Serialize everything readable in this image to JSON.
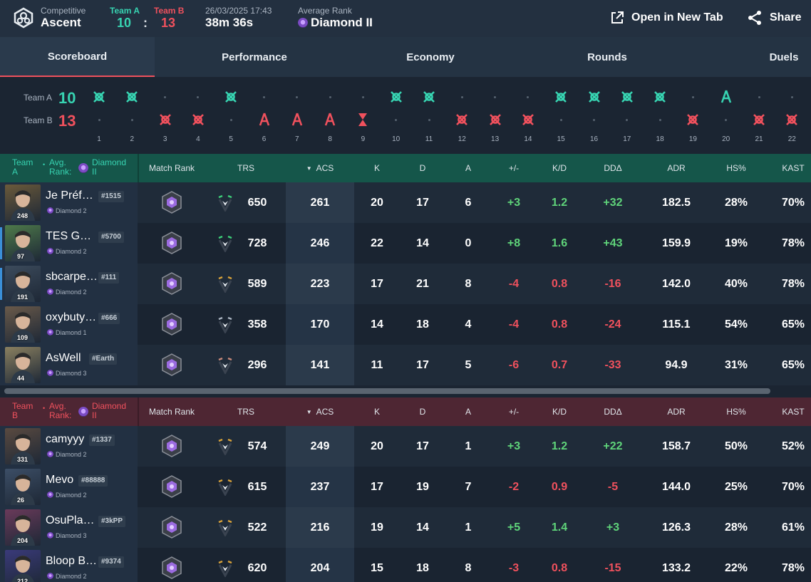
{
  "header": {
    "mode": "Competitive",
    "map": "Ascent",
    "team_a_label": "Team A",
    "team_b_label": "Team B",
    "team_a_score": "10",
    "team_b_score": "13",
    "score_sep": ":",
    "datetime": "26/03/2025 17:43",
    "duration": "38m 36s",
    "avg_rank_label": "Average Rank",
    "avg_rank": "Diamond II",
    "open_new_tab": "Open in New Tab",
    "share": "Share"
  },
  "tabs": [
    {
      "label": "Scoreboard",
      "active": true
    },
    {
      "label": "Performance",
      "active": false
    },
    {
      "label": "Economy",
      "active": false
    },
    {
      "label": "Rounds",
      "active": false
    },
    {
      "label": "Duels",
      "active": false
    }
  ],
  "rounds": {
    "team_a_label": "Team A",
    "team_b_label": "Team B",
    "team_a_score": "10",
    "team_b_score": "13",
    "numbers": [
      "1",
      "2",
      "3",
      "4",
      "5",
      "6",
      "7",
      "8",
      "9",
      "10",
      "11",
      "12",
      "13",
      "14",
      "15",
      "16",
      "17",
      "18",
      "19",
      "20",
      "21",
      "22"
    ],
    "winners": [
      "A",
      "A",
      "B",
      "B",
      "A",
      "B",
      "B",
      "B",
      "B",
      "A",
      "A",
      "B",
      "B",
      "B",
      "A",
      "A",
      "A",
      "A",
      "B",
      "A",
      "B",
      "B"
    ],
    "win_types": [
      "elim",
      "elim",
      "elim",
      "elim",
      "elim",
      "defuse",
      "defuse",
      "defuse",
      "time",
      "elim",
      "elim",
      "elim",
      "elim",
      "elim",
      "elim",
      "elim",
      "elim",
      "elim",
      "elim",
      "defuse",
      "elim",
      "elim"
    ]
  },
  "columns": [
    "Match Rank",
    "TRS",
    "ACS",
    "K",
    "D",
    "A",
    "+/-",
    "K/D",
    "DDΔ",
    "ADR",
    "HS%",
    "KAST"
  ],
  "team_a": {
    "team_label": "Team A",
    "avg_label": "Avg. Rank:",
    "avg_rank": "Diamond II",
    "players": [
      {
        "name": "Je Préf…",
        "tag": "#1515",
        "rank": "Diamond 2",
        "level": "248",
        "trs_tier": "green",
        "trs": "650",
        "acs": "261",
        "k": "20",
        "d": "17",
        "a": "6",
        "pm": "+3",
        "kd": "1.2",
        "dd": "+32",
        "adr": "182.5",
        "hs": "28%",
        "kast": "70%",
        "accent": false,
        "avatar_color": "#6b5a3a"
      },
      {
        "name": "TES GE…",
        "tag": "#5700",
        "rank": "Diamond 2",
        "level": "97",
        "trs_tier": "green",
        "trs": "728",
        "acs": "246",
        "k": "22",
        "d": "14",
        "a": "0",
        "pm": "+8",
        "kd": "1.6",
        "dd": "+43",
        "adr": "159.9",
        "hs": "19%",
        "kast": "78%",
        "accent": true,
        "avatar_color": "#4e7a4a"
      },
      {
        "name": "sbcarpe…",
        "tag": "#111",
        "rank": "Diamond 2",
        "level": "191",
        "trs_tier": "gold",
        "trs": "589",
        "acs": "223",
        "k": "17",
        "d": "21",
        "a": "8",
        "pm": "-4",
        "kd": "0.8",
        "dd": "-16",
        "adr": "142.0",
        "hs": "40%",
        "kast": "78%",
        "accent": true,
        "avatar_color": "#3c4b5c"
      },
      {
        "name": "oxybutyr…",
        "tag": "#666",
        "rank": "Diamond 1",
        "level": "109",
        "trs_tier": "silver",
        "trs": "358",
        "acs": "170",
        "k": "14",
        "d": "18",
        "a": "4",
        "pm": "-4",
        "kd": "0.8",
        "dd": "-24",
        "adr": "115.1",
        "hs": "54%",
        "kast": "65%",
        "accent": false,
        "avatar_color": "#6a5a4a"
      },
      {
        "name": "AsWell",
        "tag": "#Earth",
        "rank": "Diamond 3",
        "level": "44",
        "trs_tier": "bronze",
        "trs": "296",
        "acs": "141",
        "k": "11",
        "d": "17",
        "a": "5",
        "pm": "-6",
        "kd": "0.7",
        "dd": "-33",
        "adr": "94.9",
        "hs": "31%",
        "kast": "65%",
        "accent": false,
        "avatar_color": "#8a8060"
      }
    ]
  },
  "team_b": {
    "team_label": "Team B",
    "avg_label": "Avg. Rank:",
    "avg_rank": "Diamond II",
    "players": [
      {
        "name": "camyyy",
        "tag": "#1337",
        "rank": "Diamond 2",
        "level": "331",
        "trs_tier": "gold",
        "trs": "574",
        "acs": "249",
        "k": "20",
        "d": "17",
        "a": "1",
        "pm": "+3",
        "kd": "1.2",
        "dd": "+22",
        "adr": "158.7",
        "hs": "50%",
        "kast": "52%",
        "accent": false,
        "avatar_color": "#5a4a40"
      },
      {
        "name": "Mevo",
        "tag": "#88888",
        "rank": "Diamond 2",
        "level": "26",
        "trs_tier": "gold",
        "trs": "615",
        "acs": "237",
        "k": "17",
        "d": "19",
        "a": "7",
        "pm": "-2",
        "kd": "0.9",
        "dd": "-5",
        "adr": "144.0",
        "hs": "25%",
        "kast": "70%",
        "accent": false,
        "avatar_color": "#3c4e66"
      },
      {
        "name": "OsuPla…",
        "tag": "#3kPP",
        "rank": "Diamond 3",
        "level": "204",
        "trs_tier": "gold",
        "trs": "522",
        "acs": "216",
        "k": "19",
        "d": "14",
        "a": "1",
        "pm": "+5",
        "kd": "1.4",
        "dd": "+3",
        "adr": "126.3",
        "hs": "28%",
        "kast": "61%",
        "accent": false,
        "avatar_color": "#6a3a5a"
      },
      {
        "name": "Bloop B…",
        "tag": "#9374",
        "rank": "Diamond 2",
        "level": "212",
        "trs_tier": "gold",
        "trs": "620",
        "acs": "204",
        "k": "15",
        "d": "18",
        "a": "8",
        "pm": "-3",
        "kd": "0.8",
        "dd": "-15",
        "adr": "133.2",
        "hs": "22%",
        "kast": "78%",
        "accent": false,
        "avatar_color": "#3a3a7a"
      }
    ]
  },
  "colors": {
    "team_a": "#37d3b1",
    "team_b": "#f0515d",
    "positive": "#5fd47a",
    "negative": "#f0515d"
  }
}
